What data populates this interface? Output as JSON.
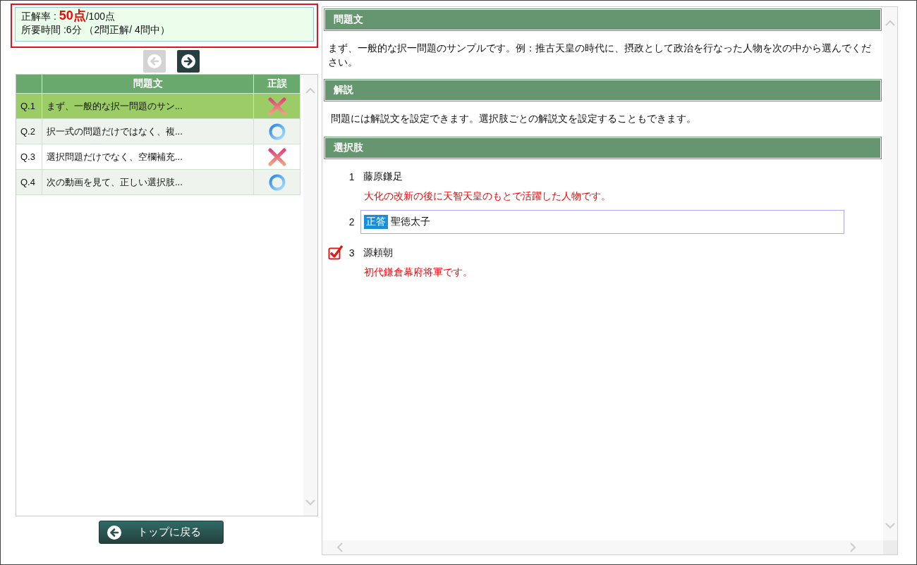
{
  "score": {
    "label": "正解率 :",
    "value": "50点",
    "total": "/100点",
    "time": "所要時間 :6分 （2問正解/ 4問中）"
  },
  "nav": [
    {
      "kind": "prev",
      "disabled": true
    },
    {
      "kind": "next",
      "disabled": false
    }
  ],
  "table": {
    "columns": [
      "問題文",
      "正誤"
    ],
    "rows": [
      {
        "number": "Q.1",
        "text": "まず、一般的な択一問題のサン...",
        "correct": false,
        "selected": true
      },
      {
        "number": "Q.2",
        "text": "択一式の問題だけではなく、複...",
        "correct": true,
        "selected": false
      },
      {
        "number": "Q.3",
        "text": "選択問題だけでなく、空欄補充...",
        "correct": false,
        "selected": false
      },
      {
        "number": "Q.4",
        "text": "次の動画を見て、正しい選択肢...",
        "correct": true,
        "selected": false
      }
    ]
  },
  "back_button": "トップに戻る",
  "question": {
    "heading": "問題文",
    "body": "まず、一般的な択一問題のサンプルです。例：推古天皇の時代に、摂政として政治を行なった人物を次の中から選んでください。"
  },
  "explanation": {
    "heading": "解説",
    "body": "問題には解説文を設定できます。選択肢ごとの解説文を設定することもできます。"
  },
  "choices": {
    "heading": "選択肢",
    "items": [
      {
        "number": "1",
        "text": "藤原鎌足",
        "checked": false,
        "correct": false,
        "comment": "大化の改新の後に天智天皇のもとで活躍した人物です。"
      },
      {
        "number": "2",
        "text": "聖徳太子",
        "checked": false,
        "correct": true,
        "badge": "正答"
      },
      {
        "number": "3",
        "text": "源頼朝",
        "checked": true,
        "correct": false,
        "comment": "初代鎌倉幕府将軍です。"
      }
    ]
  }
}
